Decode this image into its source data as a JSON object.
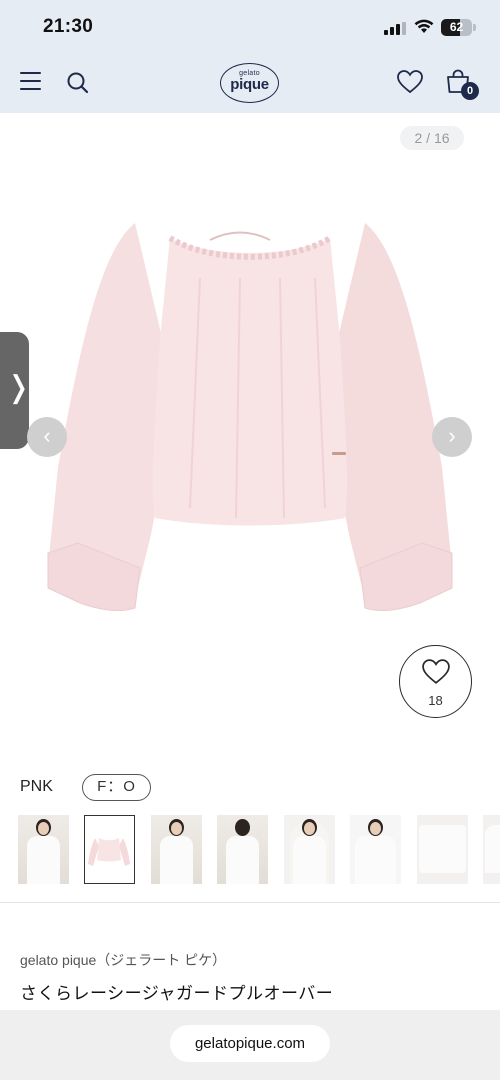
{
  "status_bar": {
    "time": "21:30",
    "battery": "62"
  },
  "header": {
    "logo_top": "gelato",
    "logo_main": "pique",
    "cart_count": "0"
  },
  "gallery": {
    "counter": "2 / 16",
    "prev_arrow": "‹",
    "next_arrow": "›",
    "side_tab_glyph": "❭",
    "favorite_count": "18",
    "image_color": "#f6dfe0"
  },
  "product": {
    "color": "PNK",
    "size": "F：O",
    "brand": "gelato pique（ジェラート ピケ）",
    "title": "さくらレーシージャガードプルオーバー"
  },
  "thumbnails": [
    {
      "name": "thumb-1"
    },
    {
      "name": "thumb-2",
      "selected": true
    },
    {
      "name": "thumb-3"
    },
    {
      "name": "thumb-4"
    },
    {
      "name": "thumb-5"
    },
    {
      "name": "thumb-6"
    },
    {
      "name": "thumb-7"
    },
    {
      "name": "thumb-8"
    }
  ],
  "browser": {
    "url": "gelatopique.com"
  },
  "icons": [
    "menu-icon",
    "search-icon",
    "heart-icon",
    "shopping-bag-icon",
    "wifi-icon",
    "signal-icon",
    "battery-icon"
  ]
}
